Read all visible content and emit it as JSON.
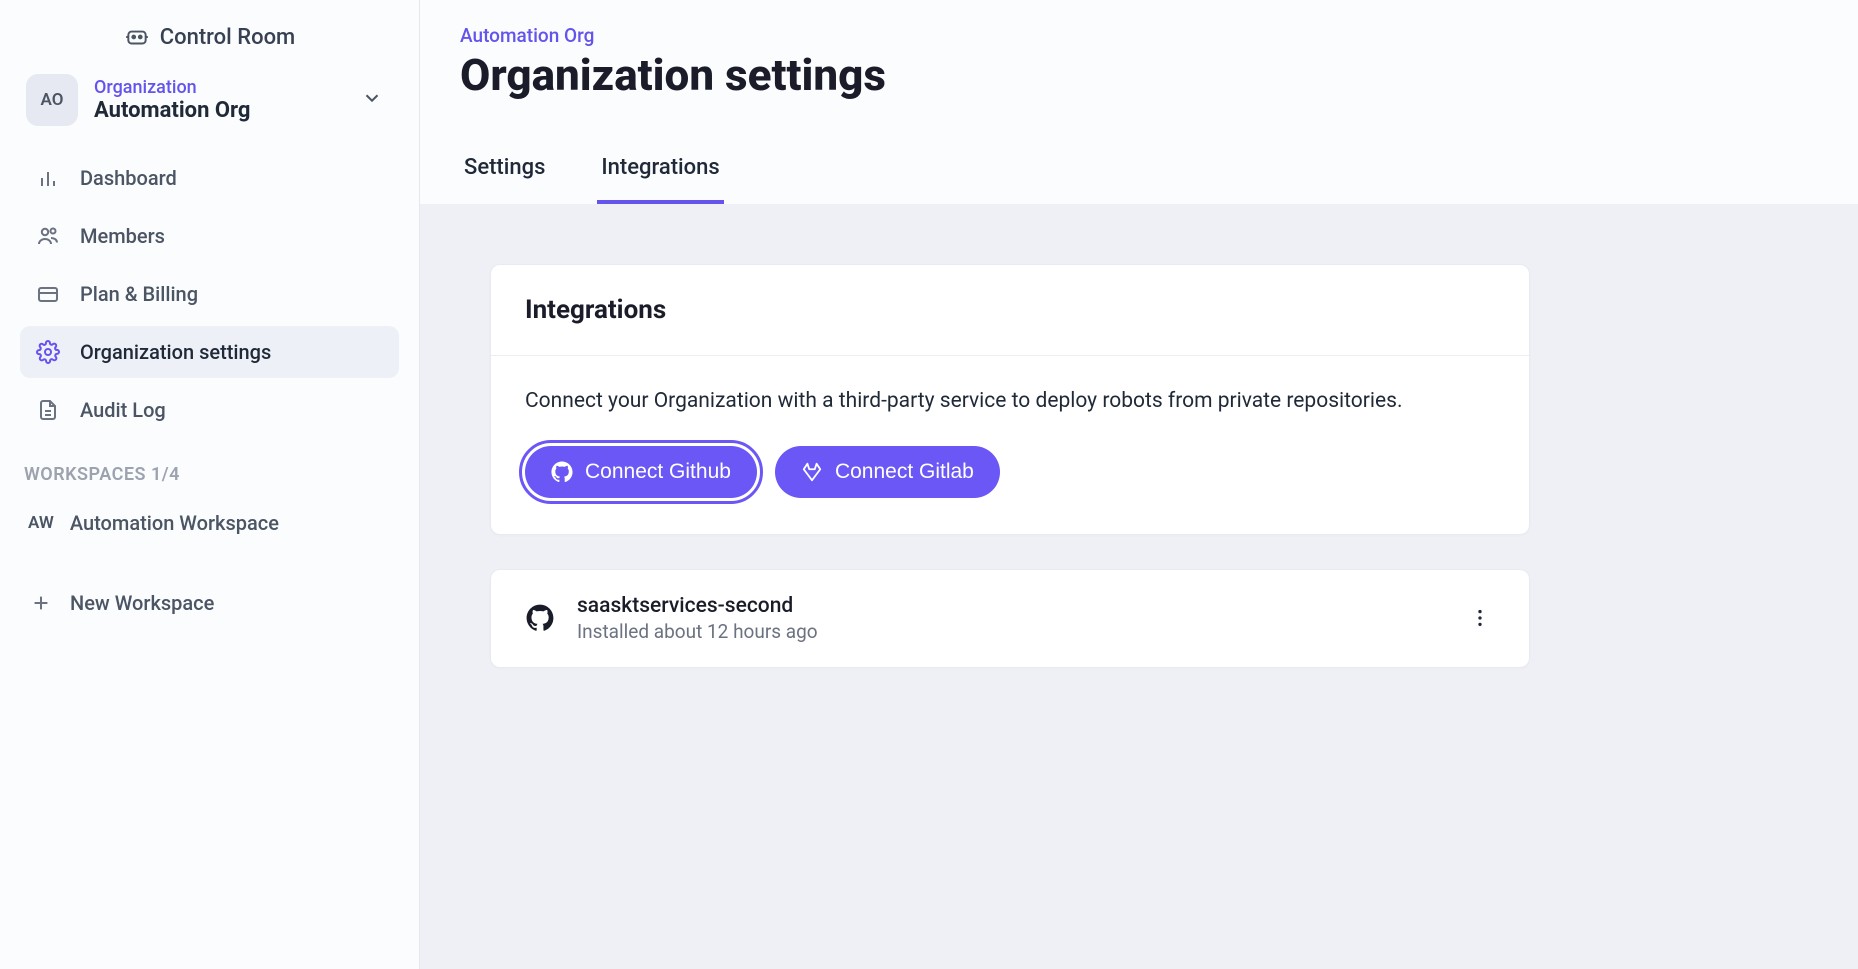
{
  "app_name": "Control Room",
  "org": {
    "avatar_initials": "AO",
    "label": "Organization",
    "name": "Automation Org"
  },
  "nav": [
    {
      "key": "dashboard",
      "label": "Dashboard",
      "icon": "chart-bar"
    },
    {
      "key": "members",
      "label": "Members",
      "icon": "users"
    },
    {
      "key": "plan-billing",
      "label": "Plan & Billing",
      "icon": "credit-card"
    },
    {
      "key": "org-settings",
      "label": "Organization settings",
      "icon": "gear",
      "active": true
    },
    {
      "key": "audit-log",
      "label": "Audit Log",
      "icon": "document"
    }
  ],
  "workspaces_header": "WORKSPACES 1/4",
  "workspaces": [
    {
      "initials": "AW",
      "name": "Automation Workspace"
    }
  ],
  "new_workspace_label": "New Workspace",
  "main": {
    "breadcrumb": "Automation Org",
    "title": "Organization settings",
    "tabs": [
      {
        "key": "settings",
        "label": "Settings"
      },
      {
        "key": "integrations",
        "label": "Integrations",
        "active": true
      }
    ],
    "integrations_card": {
      "title": "Integrations",
      "description": "Connect your Organization with a third-party service to deploy robots from private repositories.",
      "buttons": [
        {
          "key": "github",
          "label": "Connect Github",
          "focused": true
        },
        {
          "key": "gitlab",
          "label": "Connect Gitlab"
        }
      ]
    },
    "connections": [
      {
        "provider": "github",
        "name": "saasktservices-second",
        "subtitle": "Installed about 12 hours ago"
      }
    ]
  }
}
